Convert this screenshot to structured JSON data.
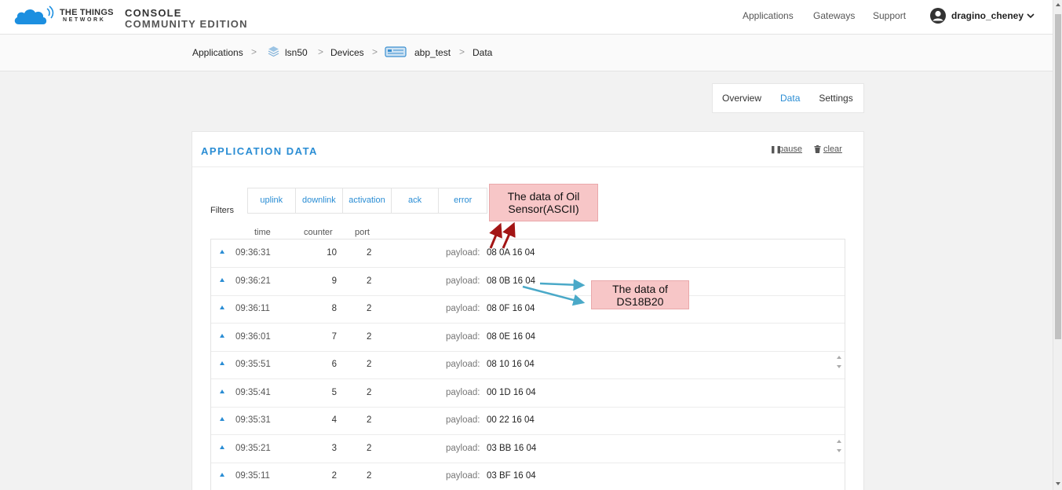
{
  "brand": {
    "line1": "THE THINGS",
    "line2": "NETWORK",
    "console": "CONSOLE",
    "edition": "COMMUNITY EDITION"
  },
  "nav": {
    "applications": "Applications",
    "gateways": "Gateways",
    "support": "Support",
    "user": "dragino_cheney"
  },
  "breadcrumb": {
    "applications": "Applications",
    "app": "lsn50",
    "devices": "Devices",
    "device": "abp_test",
    "page": "Data"
  },
  "tabs": {
    "overview": "Overview",
    "data": "Data",
    "settings": "Settings"
  },
  "card": {
    "title": "APPLICATION DATA",
    "pause": "pause",
    "clear": "clear"
  },
  "filters": {
    "label": "Filters",
    "items": [
      "uplink",
      "downlink",
      "activation",
      "ack",
      "error"
    ]
  },
  "columns": {
    "time": "time",
    "counter": "counter",
    "port": "port"
  },
  "payload_label": "payload:",
  "rows": [
    {
      "time": "09:36:31",
      "counter": "10",
      "port": "2",
      "payload": "08 0A 16 04"
    },
    {
      "time": "09:36:21",
      "counter": "9",
      "port": "2",
      "payload": "08 0B 16 04"
    },
    {
      "time": "09:36:11",
      "counter": "8",
      "port": "2",
      "payload": "08 0F 16 04"
    },
    {
      "time": "09:36:01",
      "counter": "7",
      "port": "2",
      "payload": "08 0E 16 04"
    },
    {
      "time": "09:35:51",
      "counter": "6",
      "port": "2",
      "payload": "08 10 16 04"
    },
    {
      "time": "09:35:41",
      "counter": "5",
      "port": "2",
      "payload": "00 1D 16 04"
    },
    {
      "time": "09:35:31",
      "counter": "4",
      "port": "2",
      "payload": "00 22 16 04"
    },
    {
      "time": "09:35:21",
      "counter": "3",
      "port": "2",
      "payload": "03 BB 16 04"
    },
    {
      "time": "09:35:11",
      "counter": "2",
      "port": "2",
      "payload": "03 BF 16 04"
    }
  ],
  "annotations": {
    "oil": {
      "line1": "The data of Oil",
      "line2": "Sensor(ASCII)"
    },
    "ds": {
      "line1": "The data of",
      "line2": "DS18B20"
    }
  },
  "colors": {
    "accent": "#2a8dd4",
    "note_bg": "#f7c6c7",
    "red_arrow": "#a31515",
    "blue_arrow": "#4aa9c8"
  }
}
